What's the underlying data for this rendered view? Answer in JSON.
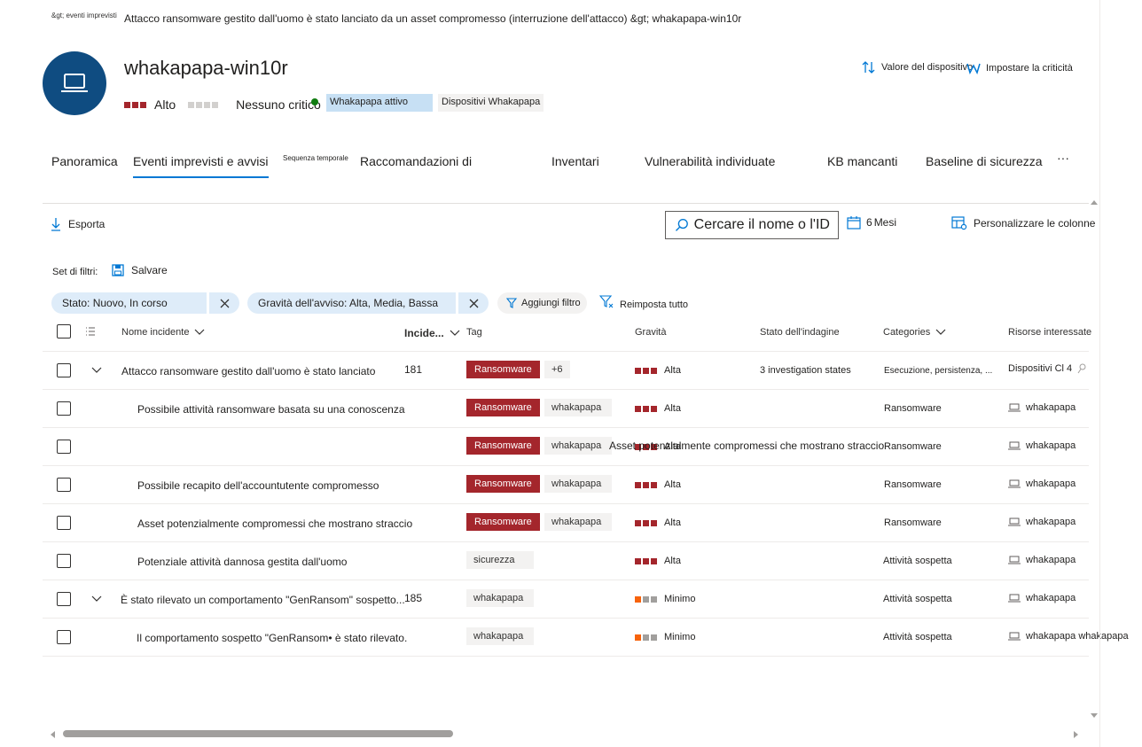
{
  "breadcrumb": {
    "small": "&gt; eventi imprevisti",
    "main": "Attacco ransomware gestito dall'uomo è stato lanciato da un asset compromesso (interruzione dell'attacco) &gt; whakapapa-win10r"
  },
  "device": {
    "title": "whakapapa-win10r",
    "risk_label": "Alto",
    "criticality_label": "Nessuno critico",
    "tag_active": "Whakapapa attivo",
    "tag_devices": "Dispositivi Whakapapa"
  },
  "header_actions": {
    "device_value": "Valore del dispositivo",
    "set_criticality": "Impostare la criticità"
  },
  "tabs": [
    {
      "label": "Panoramica"
    },
    {
      "label": "Eventi imprevisti e avvisi"
    },
    {
      "label": "Sequenza temporale"
    },
    {
      "label": "Raccomandazioni di"
    },
    {
      "label": "Inventari"
    },
    {
      "label": "Vulnerabilità individuate"
    },
    {
      "label": "KB mancanti"
    },
    {
      "label": "Baseline di sicurezza"
    },
    {
      "label": "···"
    }
  ],
  "toolbar": {
    "export": "Esporta",
    "search_placeholder": "Cercare il nome o l'ID",
    "period_value": "6",
    "period_unit": "Mesi",
    "customize": "Personalizzare le colonne"
  },
  "filters": {
    "set_label": "Set di filtri:",
    "save": "Salvare",
    "chips": [
      "Stato: Nuovo, In corso",
      "Gravità dell'avviso: Alta, Media, Bassa"
    ],
    "add": "Aggiungi filtro",
    "reset": "Reimposta tutto"
  },
  "columns": {
    "name": "Nome incidente",
    "id": "Incide...",
    "tag": "Tag",
    "severity": "Gravità",
    "investigation": "Stato dell'indagine",
    "categories": "Categories",
    "resources": "Risorse interessate"
  },
  "rows": [
    {
      "name": "Attacco ransomware gestito dall'uomo è stato lanciato",
      "id": "181",
      "tag1": "Ransomware",
      "tag2": "+6",
      "severity": "Alta",
      "investigation": "3 investigation states",
      "category": "Esecuzione, persistenza, ...",
      "resource": "Dispositivi Cl 4"
    },
    {
      "name": "Possibile attività ransomware basata su una conoscenza",
      "tag1": "Ransomware",
      "tag2": "whakapapa",
      "severity": "Alta",
      "category": "Ransomware",
      "resource": "whakapapa"
    },
    {
      "name": "",
      "tag1": "Ransomware",
      "tag2": "whakapapa",
      "overlay": "Asset potenzialmente compromessi che mostrano straccio",
      "severity": "Alta",
      "category": "Ransomware",
      "resource": "whakapapa"
    },
    {
      "name": "Possibile recapito dell'accountutente compromesso",
      "tag1": "Ransomware",
      "tag2": "whakapapa",
      "severity": "Alta",
      "category": "Ransomware",
      "resource": "whakapapa"
    },
    {
      "name": "Asset potenzialmente compromessi che mostrano straccio",
      "tag1": "Ransomware",
      "tag2": "whakapapa",
      "severity": "Alta",
      "category": "Ransomware",
      "resource": "whakapapa"
    },
    {
      "name": "Potenziale attività dannosa gestita dall'uomo",
      "tag1": "sicurezza",
      "severity": "Alta",
      "category": "Attività sospetta",
      "resource": "whakapapa"
    },
    {
      "name": "È stato rilevato un comportamento \"GenRansom\" sospetto...",
      "id": "185",
      "tag1": "whakapapa",
      "severity": "Minimo",
      "category": "Attività sospetta",
      "resource": "whakapapa"
    },
    {
      "name": "Il comportamento sospetto \"GenRansom• è stato rilevato.",
      "tag1": "whakapapa",
      "severity": "Minimo",
      "category": "Attività sospetta",
      "resource": "whakapapa whakapapa"
    }
  ],
  "colors": {
    "accent": "#0078d4",
    "avatar": "#0f4c81",
    "severity_high": "#a4262c",
    "severity_low": "#f7630c",
    "tag_red": "#a4262c"
  }
}
